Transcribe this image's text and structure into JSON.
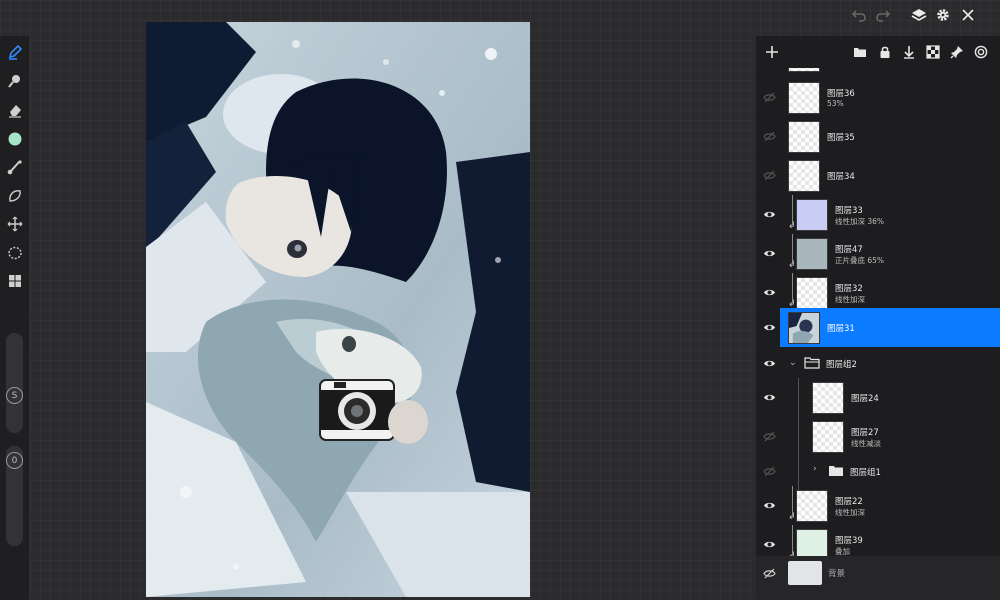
{
  "toolbar_left": {
    "tools": [
      {
        "name": "pen-icon",
        "active": true
      },
      {
        "name": "smudge-icon"
      },
      {
        "name": "eraser-icon"
      },
      {
        "name": "color-icon",
        "color": "#a5e4c5"
      },
      {
        "name": "brush-picker-icon"
      },
      {
        "name": "lasso-icon"
      },
      {
        "name": "transform-icon"
      },
      {
        "name": "selection-icon"
      },
      {
        "name": "gallery-icon"
      }
    ],
    "size_label": "S",
    "opacity_label": "0"
  },
  "top_bar": {
    "icons": [
      "undo-icon",
      "redo-icon",
      "layers-icon",
      "settings-icon",
      "close-icon"
    ]
  },
  "layer_panel": {
    "toolbar_icons": [
      "add-layer-icon",
      "new-folder-icon",
      "lock-icon",
      "merge-down-icon",
      "alpha-lock-icon",
      "pin-icon",
      "target-icon"
    ],
    "layers": [
      {
        "name": "图层36",
        "sub": "53%",
        "visible": false,
        "clipped": false
      },
      {
        "name": "图层35",
        "sub": "",
        "visible": false,
        "clipped": false
      },
      {
        "name": "图层34",
        "sub": "",
        "visible": false,
        "clipped": false
      },
      {
        "name": "图层33",
        "sub": "线性加深 36%",
        "visible": true,
        "clipped": true
      },
      {
        "name": "图层47",
        "sub": "正片叠底 65%",
        "visible": true,
        "clipped": true
      },
      {
        "name": "图层32",
        "sub": "线性加深",
        "visible": true,
        "clipped": true
      },
      {
        "name": "图层31",
        "sub": "",
        "visible": true,
        "clipped": false,
        "selected": true
      },
      {
        "name": "图层组2",
        "sub": "",
        "visible": true,
        "type": "group",
        "expanded": true
      },
      {
        "name": "图层24",
        "sub": "",
        "visible": true,
        "indent": true
      },
      {
        "name": "图层27",
        "sub": "线性减淡",
        "visible": false,
        "indent": true
      },
      {
        "name": "图层组1",
        "sub": "",
        "visible": false,
        "type": "group",
        "expanded": false,
        "indent": true
      },
      {
        "name": "图层22",
        "sub": "线性加深",
        "visible": true,
        "clipped": true
      },
      {
        "name": "图层39",
        "sub": "叠加",
        "visible": true,
        "clipped": true
      }
    ],
    "background": {
      "name": "背景",
      "visible": false
    }
  },
  "colors": {
    "accent": "#0b7bff",
    "panel": "#1d1d20",
    "workspace": "#2b2b2d",
    "active_tool": "#2f8bff"
  }
}
